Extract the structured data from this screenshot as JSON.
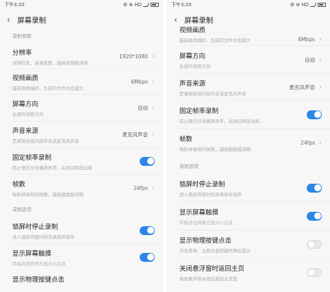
{
  "status": {
    "time": "下午3:20",
    "icons": "⚙ ⊛ HD"
  },
  "title": "屏幕录制",
  "left": {
    "section1": "录制参数",
    "resolution": {
      "title": "分辨率",
      "subtitle": "视频的宽、高像素数，越高视频越清晰",
      "value": "1920*1080"
    },
    "quality": {
      "title": "视频画质",
      "subtitle": "越高画质越好，生成的文件也会越大",
      "value": "6Mbps"
    },
    "orientation": {
      "title": "屏幕方向",
      "subtitle": "生成的视频方向",
      "value": "自动"
    },
    "audio": {
      "title": "声音来源",
      "subtitle": "是录制系统内部声音或麦克风声音",
      "value": "麦克风声音"
    },
    "fixedfps": {
      "title": "固定帧率录制",
      "subtitle": "防止微信分享播放异常，关闭后降低功耗",
      "on": true
    },
    "fps": {
      "title": "帧数",
      "subtitle": "每秒钟录制的帧数，越高画面越流畅",
      "value": "24fps"
    },
    "section2": "录制选项",
    "lockstop": {
      "title": "锁屏时停止录制",
      "subtitle": "进入锁屏界面时结束录屏并保存",
      "on": true
    },
    "touches": {
      "title": "显示屏幕触摸",
      "subtitle": "手指点击的地方显示小白点",
      "on": true
    },
    "cutoff": {
      "title": "显示物理按键点击"
    }
  },
  "right": {
    "quality": {
      "title": "视频画质",
      "subtitle": "越高画质越好，生成的文件也会越大",
      "value": "6Mbps"
    },
    "orientation": {
      "title": "屏幕方向",
      "subtitle": "生成的视频方向",
      "value": "自动"
    },
    "audio": {
      "title": "声音来源",
      "subtitle": "是录制系统内部声音或麦克风声音",
      "value": "麦克风声音"
    },
    "fixedfps": {
      "title": "固定帧率录制",
      "subtitle": "防止微信分享播放异常，关闭后降低功耗",
      "on": true
    },
    "fps": {
      "title": "帧数",
      "subtitle": "每秒钟录制的帧数，越高画面越流畅",
      "value": "24fps"
    },
    "section2": "录制选项",
    "lockstop": {
      "title": "锁屏时停止录制",
      "subtitle": "进入锁屏界面时结束录屏并保存",
      "on": true
    },
    "touches": {
      "title": "显示屏幕触摸",
      "subtitle": "手指点击的地方显示小白点",
      "on": true
    },
    "physkeys": {
      "title": "显示物理按键点击",
      "subtitle": "点击菜单、主屏及返回键时弹出提示",
      "on": false
    },
    "floatwin": {
      "title": "关闭悬浮窗时返回主页",
      "subtitle": "录屏悬浮窗关闭后返回主页面",
      "on": false
    }
  },
  "colors": {
    "accent": "#2c86e6",
    "background": "#f7f7f7"
  }
}
